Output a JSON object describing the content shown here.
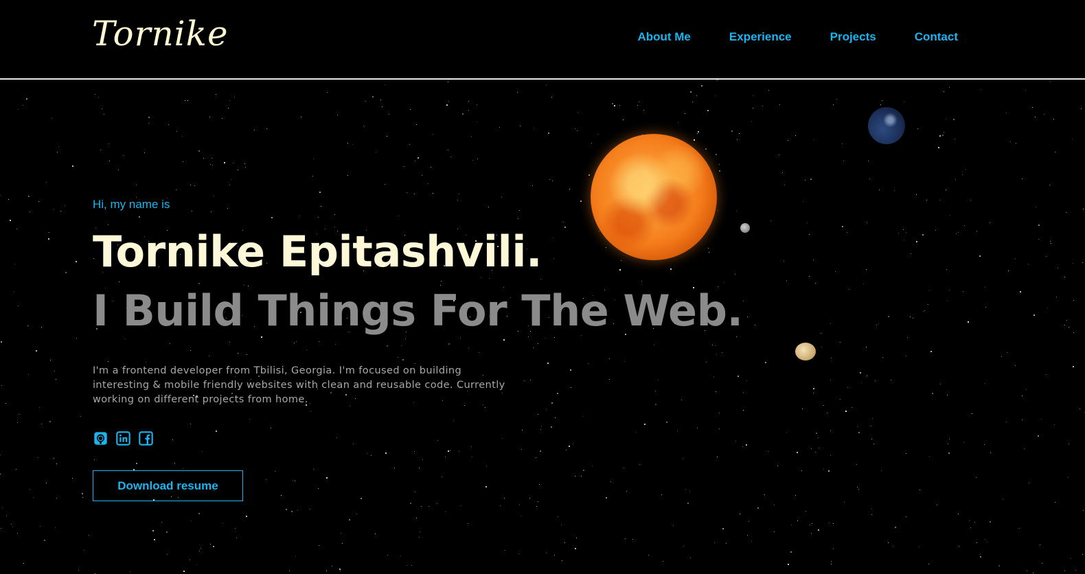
{
  "header": {
    "logo": "Tornike",
    "nav": [
      {
        "label": "About Me"
      },
      {
        "label": "Experience"
      },
      {
        "label": "Projects"
      },
      {
        "label": "Contact"
      }
    ]
  },
  "hero": {
    "greeting": "Hi, my name is",
    "name": "Tornike Epitashvili.",
    "tagline": "I Build Things For The Web.",
    "bio": "I'm a frontend developer from Tbilisi, Georgia. I'm focused on building interesting & mobile friendly websites with clean and reusable code. Currently working on different projects from home.",
    "socials": [
      {
        "icon": "github-icon"
      },
      {
        "icon": "linkedin-icon"
      },
      {
        "icon": "facebook-icon"
      }
    ],
    "cta_label": "Download resume"
  },
  "colors": {
    "accent": "#1ab4f0",
    "logo": "#fdf7d2",
    "name": "#fdf9d8",
    "tagline": "#8b8b8b",
    "background": "#000000"
  }
}
